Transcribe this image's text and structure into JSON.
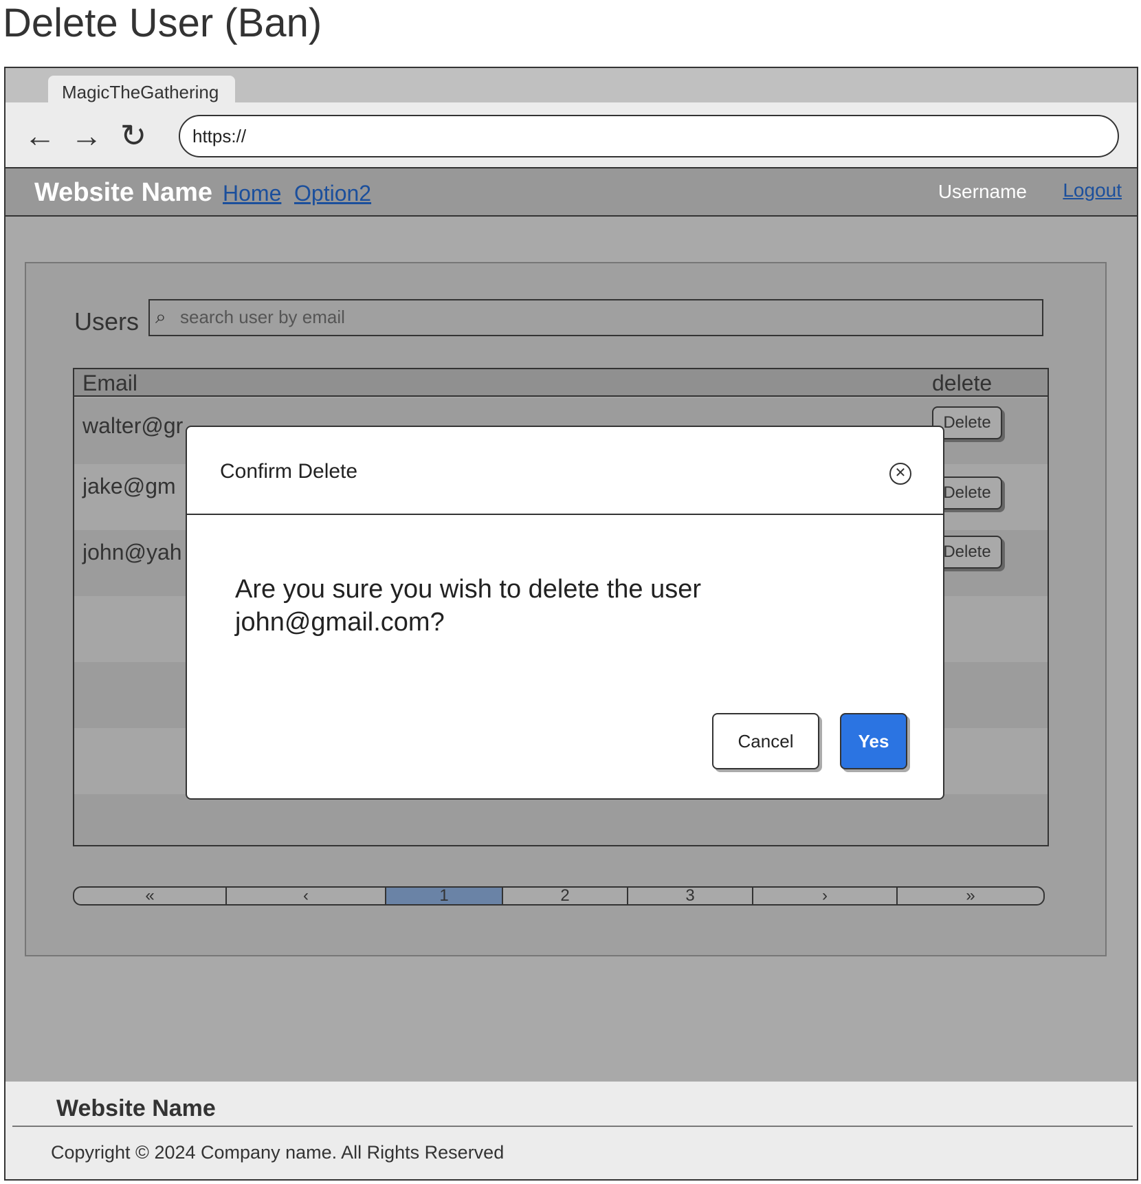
{
  "page": {
    "title": "Delete User (Ban)"
  },
  "browser": {
    "tab_title": "MagicTheGathering",
    "url": "https://",
    "icons": {
      "back": "arrow-left-icon",
      "forward": "arrow-right-icon",
      "reload": "reload-icon"
    }
  },
  "sitenav": {
    "brand": "Website Name",
    "links": [
      "Home",
      "Option2"
    ],
    "username": "Username",
    "logout": "Logout"
  },
  "users": {
    "label": "Users",
    "search_placeholder": "search user by email",
    "columns": {
      "email": "Email",
      "delete": "delete"
    },
    "rows": [
      {
        "email": "walter@gr",
        "action": "Delete"
      },
      {
        "email": "jake@gm",
        "action": "Delete"
      },
      {
        "email": "john@yah",
        "action": "Delete"
      }
    ]
  },
  "pagination": {
    "items": [
      "«",
      "‹",
      "1",
      "2",
      "3",
      "›",
      "»"
    ],
    "current": "1",
    "active_color": "#6a83a6"
  },
  "modal": {
    "title": "Confirm Delete",
    "message": "Are you sure you wish to delete the user john@gmail.com?",
    "cancel_label": "Cancel",
    "confirm_label": "Yes",
    "confirm_color": "#2b74e2"
  },
  "footer": {
    "brand": "Website Name",
    "copyright": "Copyright © 2024 Company name. All Rights Reserved"
  }
}
